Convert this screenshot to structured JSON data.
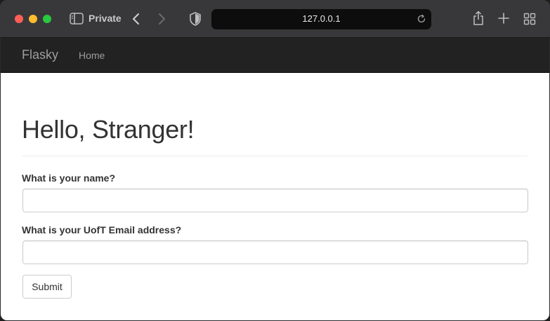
{
  "browser": {
    "mode_label": "Private",
    "url": "127.0.0.1",
    "traffic_colors": {
      "close": "#fe5f57",
      "minimize": "#febc2e",
      "zoom": "#28c840"
    },
    "icons": [
      "sidebar-icon",
      "back-icon",
      "forward-icon",
      "shield-icon",
      "reload-icon",
      "share-icon",
      "plus-icon",
      "tab-overview-icon"
    ]
  },
  "navbar": {
    "brand": "Flasky",
    "links": [
      "Home"
    ],
    "background": "#222222"
  },
  "main": {
    "heading": "Hello, Stranger!",
    "form": {
      "name_label": "What is your name?",
      "name_value": "",
      "email_label": "What is your UofT Email address?",
      "email_value": "",
      "submit_label": "Submit"
    }
  }
}
